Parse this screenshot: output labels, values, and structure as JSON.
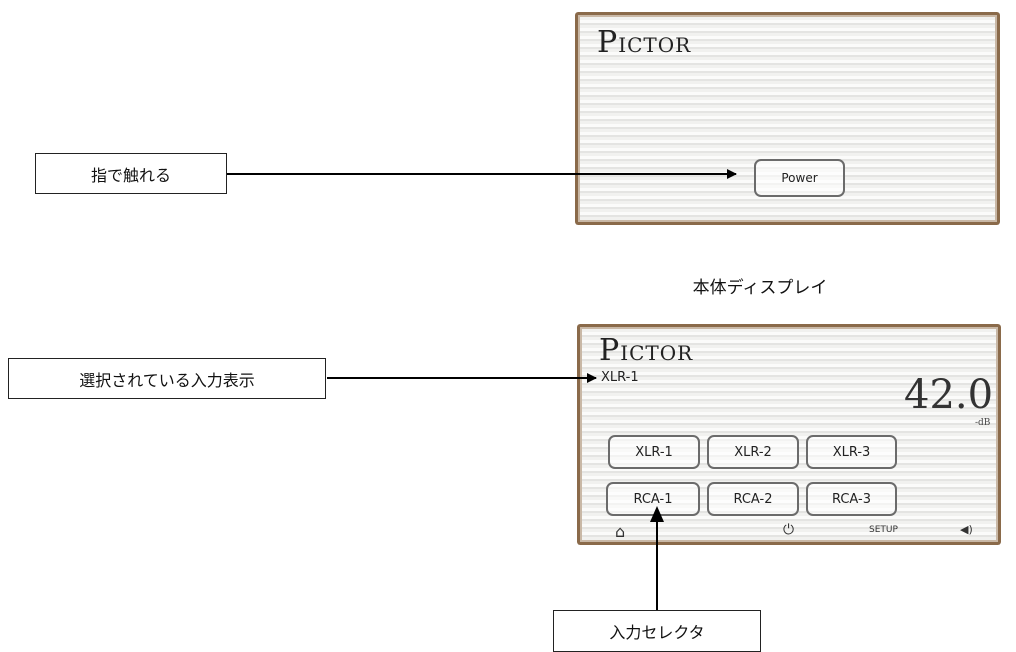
{
  "top_screen": {
    "logo_initial": "P",
    "logo_rest": "ictor",
    "power_button_label": "Power"
  },
  "bottom_screen": {
    "logo_initial": "P",
    "logo_rest": "ictor",
    "selected_input": "XLR-1",
    "volume_value": "42.0",
    "volume_unit": "-dB",
    "input_buttons": [
      {
        "label": "XLR-1"
      },
      {
        "label": "XLR-2"
      },
      {
        "label": "XLR-3"
      },
      {
        "label": "RCA-1"
      },
      {
        "label": "RCA-2"
      },
      {
        "label": "RCA-3"
      }
    ],
    "footer": {
      "home_icon": "⌂",
      "power_icon": "⏻",
      "setup_label": "SETUP",
      "speaker_icon": "◀)"
    }
  },
  "annotations": {
    "touch_label": "指で触れる",
    "selected_input_label": "選択されている入力表示",
    "selector_label": "入力セレクタ",
    "display_caption": "本体ディスプレイ"
  }
}
